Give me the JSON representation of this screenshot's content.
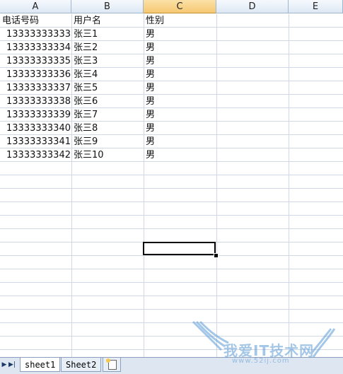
{
  "columns": [
    {
      "label": "A"
    },
    {
      "label": "B"
    },
    {
      "label": "C"
    },
    {
      "label": "D"
    },
    {
      "label": "E"
    }
  ],
  "selected_column": "C",
  "rows": [
    {
      "phone": "电话号码",
      "username": "用户名",
      "gender": "性别"
    },
    {
      "phone": "13333333333",
      "username": "张三1",
      "gender": "男"
    },
    {
      "phone": "13333333334",
      "username": "张三2",
      "gender": "男"
    },
    {
      "phone": "13333333335",
      "username": "张三3",
      "gender": "男"
    },
    {
      "phone": "13333333336",
      "username": "张三4",
      "gender": "男"
    },
    {
      "phone": "13333333337",
      "username": "张三5",
      "gender": "男"
    },
    {
      "phone": "13333333338",
      "username": "张三6",
      "gender": "男"
    },
    {
      "phone": "13333333339",
      "username": "张三7",
      "gender": "男"
    },
    {
      "phone": "13333333340",
      "username": "张三8",
      "gender": "男"
    },
    {
      "phone": "13333333341",
      "username": "张三9",
      "gender": "男"
    },
    {
      "phone": "13333333342",
      "username": "张三10",
      "gender": "男"
    }
  ],
  "sheet_tabs": [
    {
      "label": "sheet1",
      "active": true
    },
    {
      "label": "Sheet2",
      "active": false
    }
  ],
  "watermark": {
    "text": "我爱IT技术网",
    "url": "www.52ij.com"
  },
  "colors": {
    "header_selected": "#f6c872",
    "gridline": "#d0d7e5",
    "watermark": "#5b9bd5"
  }
}
